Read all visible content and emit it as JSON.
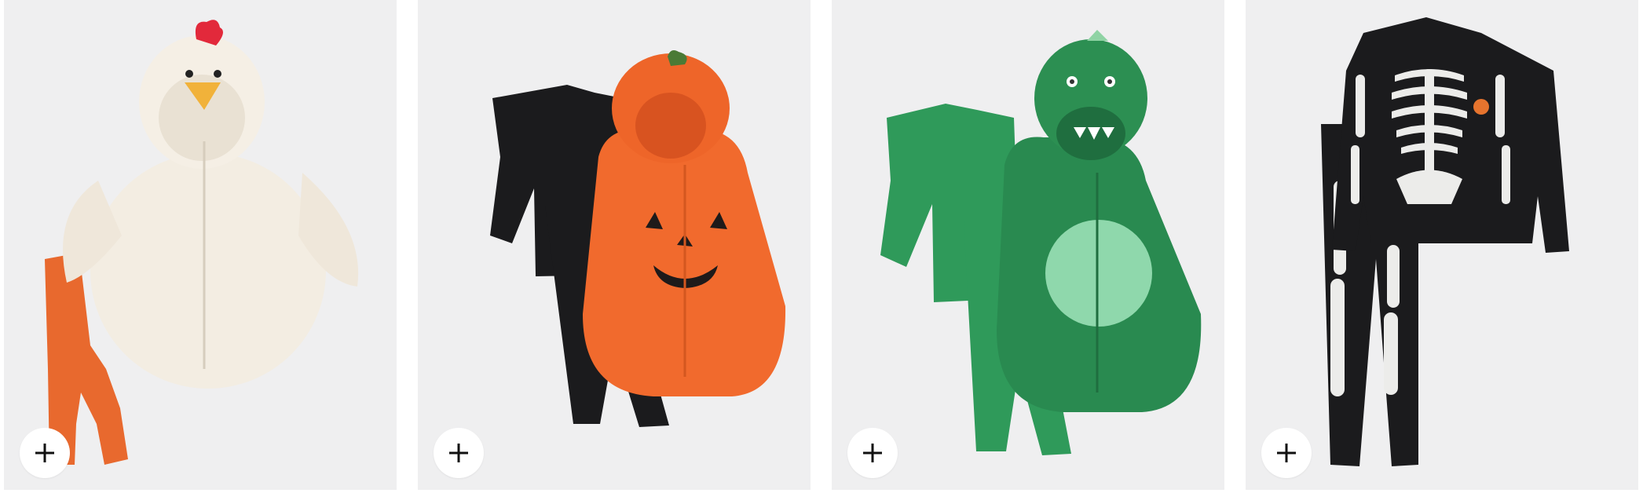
{
  "products": [
    {
      "name": "chicken-costume",
      "action_icon": "plus-icon"
    },
    {
      "name": "pumpkin-costume",
      "action_icon": "plus-icon"
    },
    {
      "name": "dinosaur-costume",
      "action_icon": "plus-icon"
    },
    {
      "name": "skeleton-pajamas",
      "action_icon": "plus-icon"
    }
  ],
  "colors": {
    "card_bg": "#efeff0",
    "button_bg": "#ffffff",
    "icon": "#111111"
  }
}
